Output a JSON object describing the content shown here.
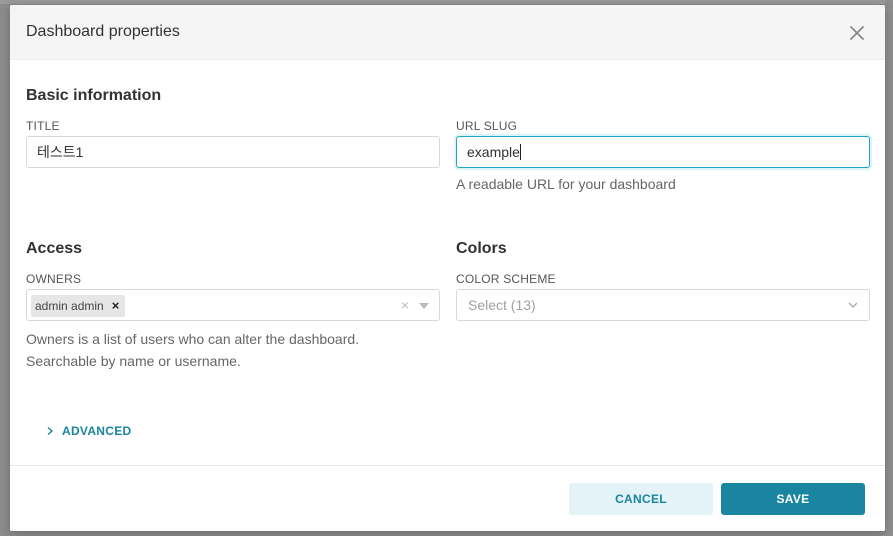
{
  "modal": {
    "title": "Dashboard properties"
  },
  "basic_info": {
    "heading": "Basic information",
    "title_label": "TITLE",
    "title_value": "테스트1",
    "slug_label": "URL SLUG",
    "slug_value": "example",
    "slug_help": "A readable URL for your dashboard"
  },
  "access": {
    "heading": "Access",
    "owners_label": "OWNERS",
    "owners": [
      "admin admin"
    ],
    "owners_help_line1": "Owners is a list of users who can alter the dashboard.",
    "owners_help_line2": "Searchable by name or username."
  },
  "colors": {
    "heading": "Colors",
    "scheme_label": "COLOR SCHEME",
    "scheme_placeholder": "Select (13)"
  },
  "advanced": {
    "label": "ADVANCED"
  },
  "footer": {
    "cancel_label": "CANCEL",
    "save_label": "SAVE"
  },
  "theme": {
    "primary": "#1a85a0",
    "focus_border": "#20a7c9",
    "cancel_bg": "#e3f3f8"
  }
}
